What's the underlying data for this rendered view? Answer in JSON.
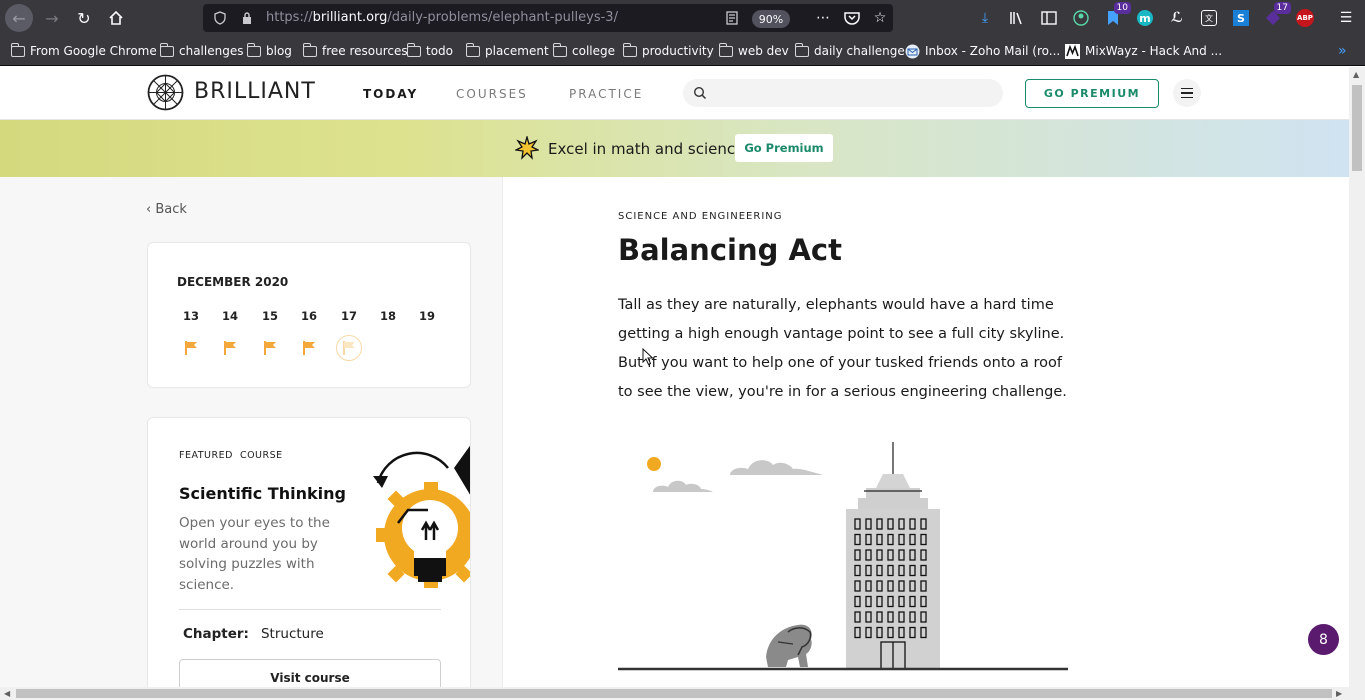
{
  "browser": {
    "url_prefix": "https://",
    "url_host": "brilliant.org",
    "url_path": "/daily-problems/elephant-pulleys-3/",
    "zoom": "90%",
    "badges": {
      "ext_count_1": "10",
      "ext_count_2": "17",
      "abp": "ABP"
    },
    "bookmarks": [
      "From Google Chrome",
      "challenges",
      "blog",
      "free resources",
      "todo",
      "placement",
      "college",
      "productivity",
      "web dev",
      "daily challenge",
      "Inbox - Zoho Mail (ro...",
      "MixWayz - Hack And ..."
    ],
    "colors": {
      "chrome": "#38383d",
      "urlbar": "#1c1b22"
    }
  },
  "site": {
    "logo": "BRILLIANT",
    "nav": [
      "TODAY",
      "COURSES",
      "PRACTICE"
    ],
    "search_placeholder": "",
    "premium_button": "GO PREMIUM",
    "brand_color": "#1b8a6b"
  },
  "promo": {
    "text": "Excel in math and science",
    "button": "Go Premium"
  },
  "sidebar": {
    "back": "Back",
    "calendar": {
      "month": "DECEMBER 2020",
      "days": [
        "13",
        "14",
        "15",
        "16",
        "17",
        "18",
        "19"
      ],
      "flag_color": "#f4a73a"
    },
    "featured": {
      "label": "FEATURED  COURSE",
      "title": "Scientific Thinking",
      "description": "Open your eyes to the world around you by solving puzzles with science.",
      "chapter_label": "Chapter:",
      "chapter_value": "Structure",
      "button": "Visit course"
    }
  },
  "problem": {
    "category": "SCIENCE AND ENGINEERING",
    "title": "Balancing Act",
    "body": "Tall as they are naturally, elephants would have a hard time getting a high enough vantage point to see a full city skyline. But if you want to help one of your tusked friends onto a roof to see the view, you're in for a serious engineering challenge."
  },
  "chat_badge": "8"
}
